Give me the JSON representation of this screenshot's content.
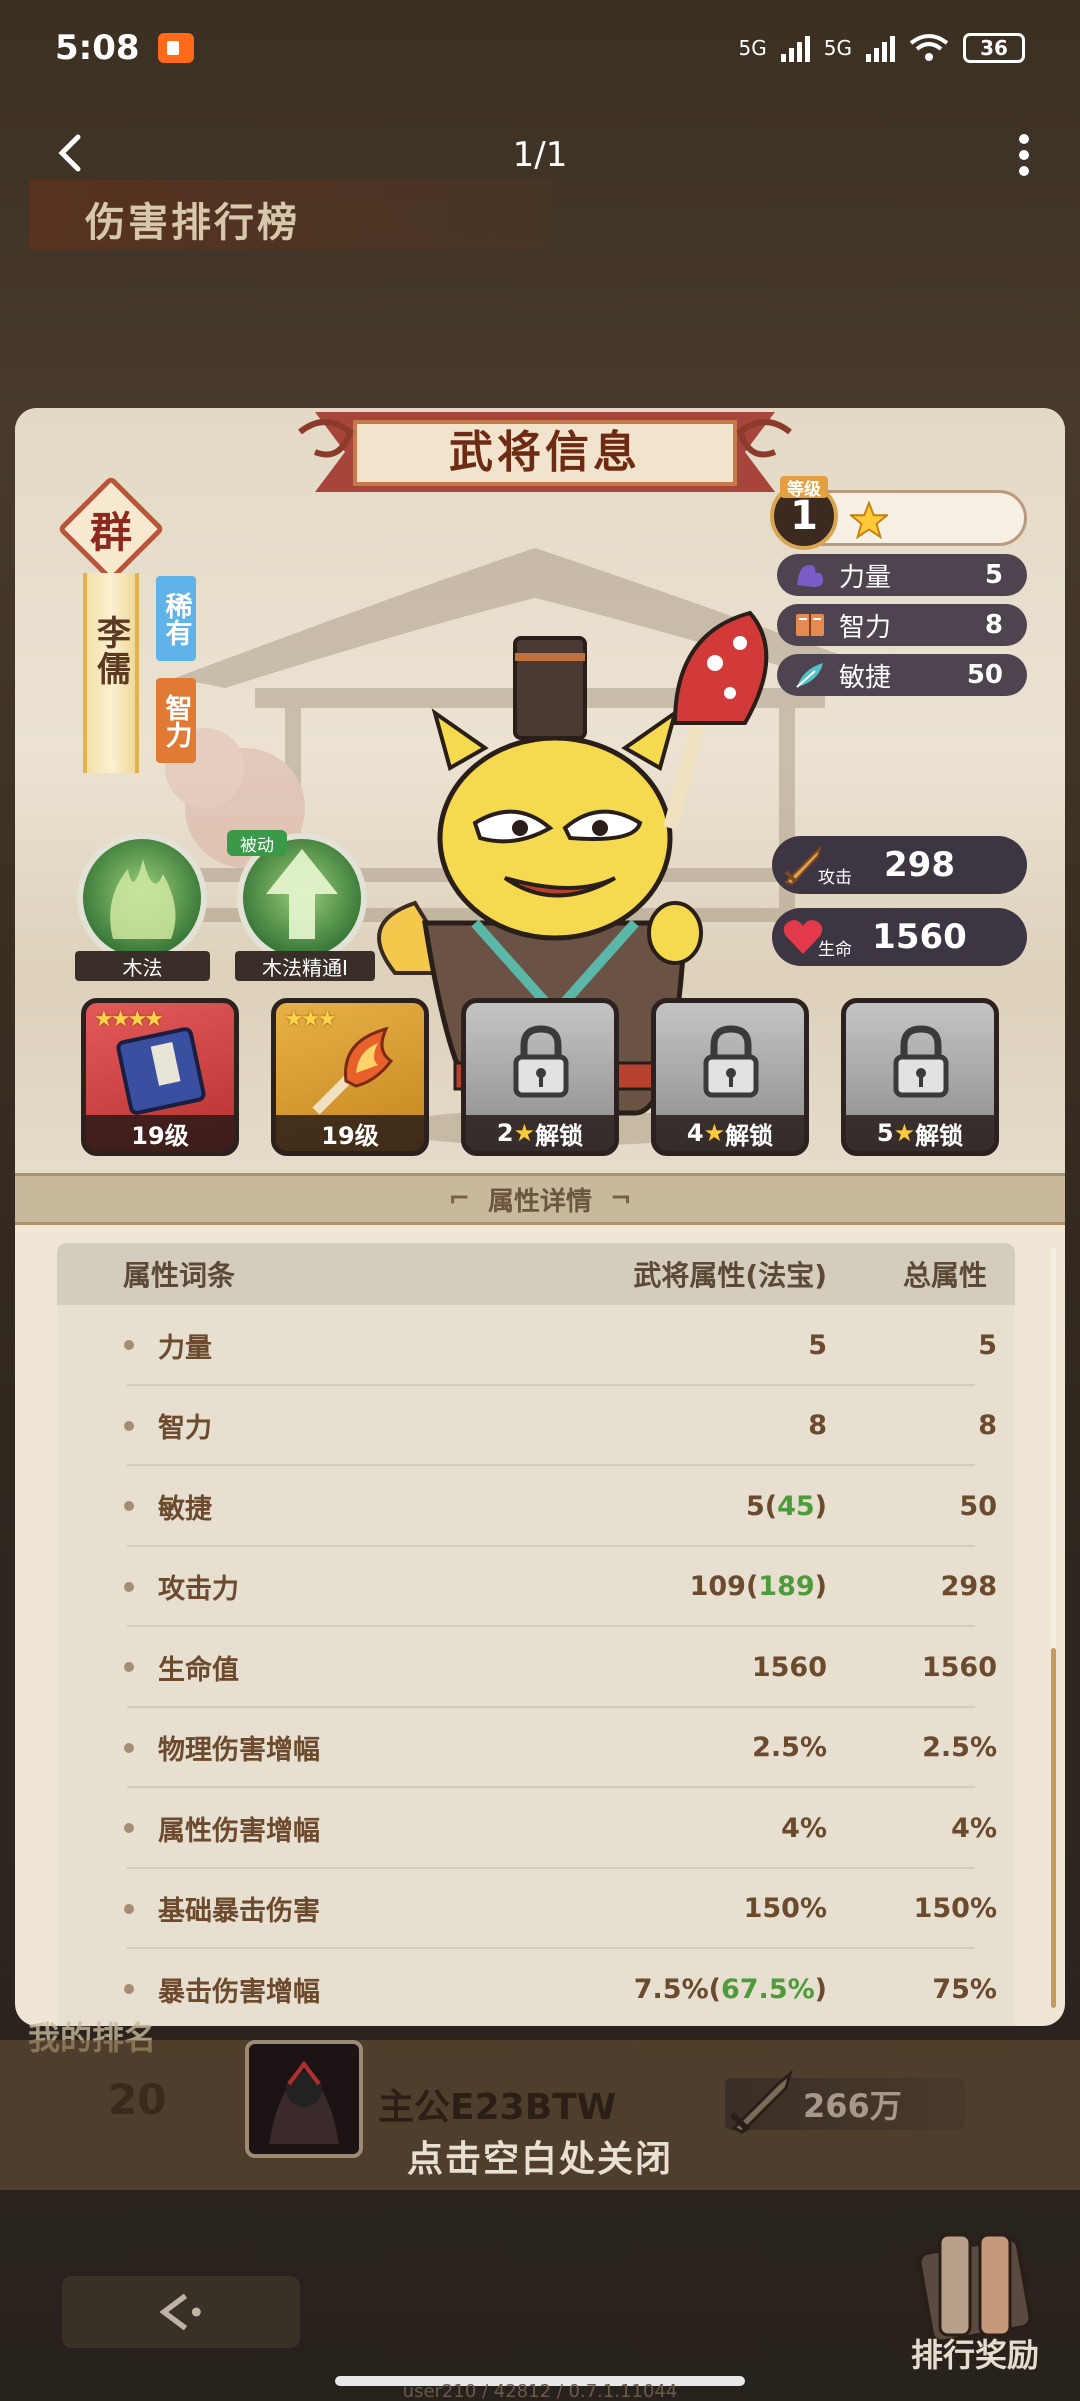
{
  "status_bar": {
    "time": "5:08",
    "net1": "5G",
    "net2": "5G",
    "battery": "36"
  },
  "nav": {
    "page_count": "1/1"
  },
  "background": {
    "rank_title": "伤害排行榜",
    "my_rank_label": "我的排名",
    "my_rank_number": "20",
    "player_name": "主公E23BTW",
    "player_power": "266万",
    "close_hint": "点击空白处关闭",
    "reward_label": "排行奖励",
    "version": "user210 / 42812 / 0.7.1.11044"
  },
  "card": {
    "title": "武将信息",
    "faction": "群",
    "hero_name": "李儒",
    "rarity_tag": "稀有",
    "type_tag": "智力",
    "level_label": "等级",
    "level": "1",
    "stats": [
      {
        "label": "力量",
        "value": "5",
        "icon": "muscle-icon"
      },
      {
        "label": "智力",
        "value": "8",
        "icon": "book-icon"
      },
      {
        "label": "敏捷",
        "value": "50",
        "icon": "feather-icon"
      }
    ],
    "attack": {
      "label": "攻击",
      "value": "298"
    },
    "hp": {
      "label": "生命",
      "value": "1560"
    },
    "skills": [
      {
        "label": "木法",
        "passive": ""
      },
      {
        "label": "木法精通I",
        "passive": "被动"
      }
    ],
    "slots": [
      {
        "caption": "19级",
        "stars": "★★★★"
      },
      {
        "caption": "19级",
        "stars": "★★★"
      },
      {
        "caption_num": "2",
        "caption_text": "解锁"
      },
      {
        "caption_num": "4",
        "caption_text": "解锁"
      },
      {
        "caption_num": "5",
        "caption_text": "解锁"
      }
    ],
    "attr_section_title": "属性详情",
    "table": {
      "headers": [
        "属性词条",
        "武将属性(法宝)",
        "总属性"
      ],
      "rows": [
        {
          "name": "力量",
          "base": "5",
          "bonus": "",
          "total": "5"
        },
        {
          "name": "智力",
          "base": "8",
          "bonus": "",
          "total": "8"
        },
        {
          "name": "敏捷",
          "base": "5",
          "bonus": "45",
          "total": "50"
        },
        {
          "name": "攻击力",
          "base": "109",
          "bonus": "189",
          "total": "298"
        },
        {
          "name": "生命值",
          "base": "1560",
          "bonus": "",
          "total": "1560"
        },
        {
          "name": "物理伤害增幅",
          "base": "2.5%",
          "bonus": "",
          "total": "2.5%"
        },
        {
          "name": "属性伤害增幅",
          "base": "4%",
          "bonus": "",
          "total": "4%"
        },
        {
          "name": "基础暴击伤害",
          "base": "150%",
          "bonus": "",
          "total": "150%"
        },
        {
          "name": "暴击伤害增幅",
          "base": "7.5%",
          "bonus": "67.5%",
          "total": "75%"
        }
      ]
    }
  },
  "colors": {
    "card_bg": "#efe6d6",
    "accent_red": "#6d2b14",
    "bonus_green": "#4f9a3a",
    "pill_dark": "#4d4450"
  }
}
